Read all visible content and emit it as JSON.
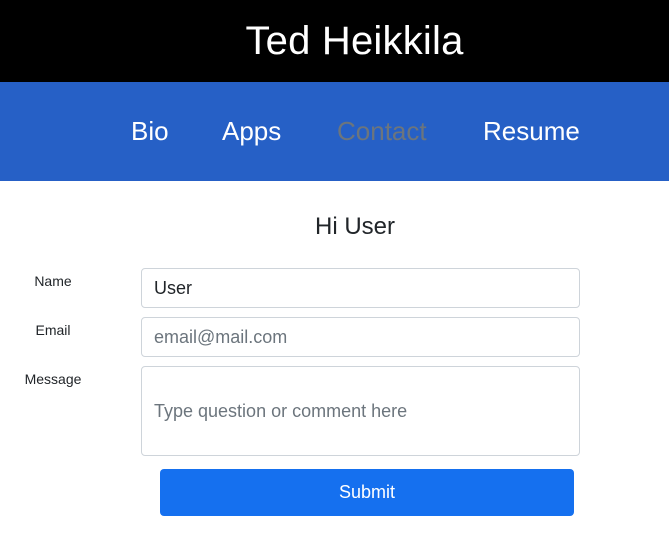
{
  "header": {
    "title": "Ted Heikkila"
  },
  "nav": {
    "items": [
      {
        "label": "Bio",
        "active": false
      },
      {
        "label": "Apps",
        "active": false
      },
      {
        "label": "Contact",
        "active": true
      },
      {
        "label": "Resume",
        "active": false
      }
    ]
  },
  "form": {
    "greeting": "Hi User",
    "name": {
      "label": "Name",
      "value": "User",
      "placeholder": ""
    },
    "email": {
      "label": "Email",
      "value": "",
      "placeholder": "email@mail.com"
    },
    "message": {
      "label": "Message",
      "value": "",
      "placeholder": "Type question or comment here"
    },
    "submit_label": "Submit"
  },
  "colors": {
    "header_bg": "#000000",
    "nav_bg": "#2660c6",
    "nav_active_text": "#6c757d",
    "submit_bg": "#1570ef"
  }
}
